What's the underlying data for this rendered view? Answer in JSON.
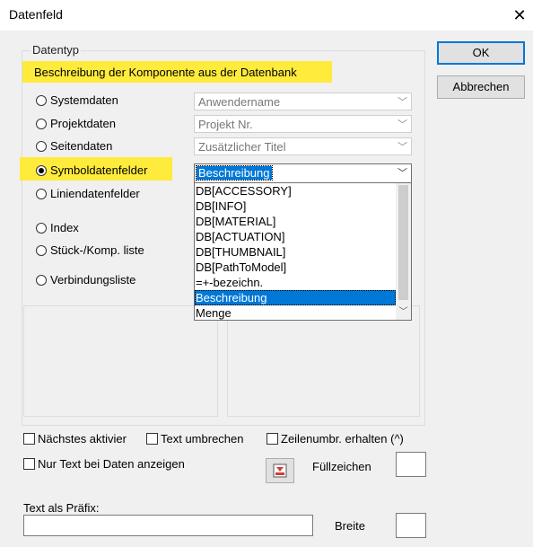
{
  "window": {
    "title": "Datenfeld"
  },
  "group": {
    "legend": "Datentyp",
    "description": "Beschreibung der Komponente aus der Datenbank"
  },
  "radios": [
    {
      "label": "Systemdaten",
      "selected": false
    },
    {
      "label": "Projektdaten",
      "selected": false
    },
    {
      "label": "Seitendaten",
      "selected": false
    },
    {
      "label": "Symboldatenfelder",
      "selected": true
    },
    {
      "label": "Liniendatenfelder",
      "selected": false
    },
    {
      "label": "Index",
      "selected": false
    },
    {
      "label": "Stück-/Komp. liste",
      "selected": false
    },
    {
      "label": "Verbindungsliste",
      "selected": false
    }
  ],
  "combos": {
    "system": "Anwendername",
    "project": "Projekt Nr.",
    "page": "Zusätzlicher Titel",
    "symbol": "Beschreibung"
  },
  "list": {
    "items": [
      "DB[ACCESSORY]",
      "DB[INFO]",
      "DB[MATERIAL]",
      "DB[ACTUATION]",
      "DB[THUMBNAIL]",
      "DB[PathToModel]",
      "=+-bezeichn.",
      "Beschreibung",
      "Menge"
    ],
    "selected_index": 7
  },
  "buttons": {
    "ok": "OK",
    "cancel": "Abbrechen"
  },
  "options": {
    "next_activate": "Nächstes aktivier",
    "wrap_text": "Text umbrechen",
    "keep_linebreaks": "Zeilenumbr. erhalten (^)",
    "text_only_with_data": "Nur Text bei Daten anzeigen",
    "fill_char_label": "Füllzeichen",
    "fill_char_value": ""
  },
  "prefix": {
    "label": "Text als Präfix:",
    "value": "",
    "width_label": "Breite",
    "width_value": ""
  },
  "colors": {
    "highlight": "#ffeb3b",
    "selection": "#0078d7"
  }
}
